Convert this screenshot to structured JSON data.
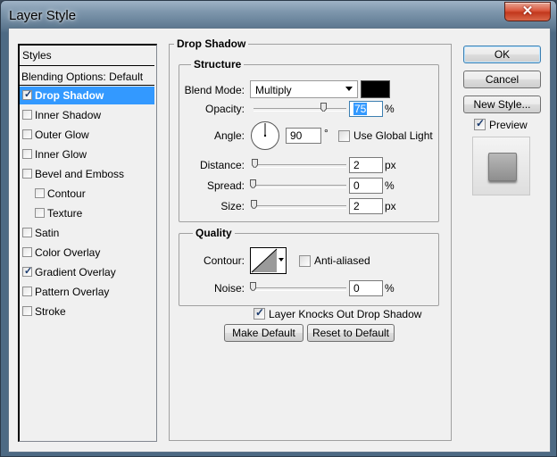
{
  "window": {
    "title": "Layer Style",
    "close_label": "✕"
  },
  "styles_panel": {
    "header": "Styles",
    "blending_options": "Blending Options: Default",
    "items": [
      {
        "label": "Drop Shadow",
        "checked": true,
        "active": true,
        "indent": 0
      },
      {
        "label": "Inner Shadow",
        "checked": false,
        "active": false,
        "indent": 0
      },
      {
        "label": "Outer Glow",
        "checked": false,
        "active": false,
        "indent": 0
      },
      {
        "label": "Inner Glow",
        "checked": false,
        "active": false,
        "indent": 0
      },
      {
        "label": "Bevel and Emboss",
        "checked": false,
        "active": false,
        "indent": 0
      },
      {
        "label": "Contour",
        "checked": false,
        "active": false,
        "indent": 1
      },
      {
        "label": "Texture",
        "checked": false,
        "active": false,
        "indent": 1
      },
      {
        "label": "Satin",
        "checked": false,
        "active": false,
        "indent": 0
      },
      {
        "label": "Color Overlay",
        "checked": false,
        "active": false,
        "indent": 0
      },
      {
        "label": "Gradient Overlay",
        "checked": true,
        "active": false,
        "indent": 0
      },
      {
        "label": "Pattern Overlay",
        "checked": false,
        "active": false,
        "indent": 0
      },
      {
        "label": "Stroke",
        "checked": false,
        "active": false,
        "indent": 0
      }
    ]
  },
  "drop_shadow": {
    "title": "Drop Shadow",
    "structure": {
      "title": "Structure",
      "blend_mode_label": "Blend Mode:",
      "blend_mode_value": "Multiply",
      "shadow_color": "#000000",
      "opacity_label": "Opacity:",
      "opacity_value": "75",
      "opacity_unit": "%",
      "opacity_fraction": 0.75,
      "angle_label": "Angle:",
      "angle_value": "90",
      "angle_unit": "°",
      "use_global_light": "Use Global Light",
      "use_global_light_checked": false,
      "distance_label": "Distance:",
      "distance_value": "2",
      "distance_unit": "px",
      "spread_label": "Spread:",
      "spread_value": "0",
      "spread_unit": "%",
      "size_label": "Size:",
      "size_value": "2",
      "size_unit": "px"
    },
    "quality": {
      "title": "Quality",
      "contour_label": "Contour:",
      "anti_aliased": "Anti-aliased",
      "anti_aliased_checked": false,
      "noise_label": "Noise:",
      "noise_value": "0",
      "noise_unit": "%"
    },
    "layer_knocks_out": "Layer Knocks Out Drop Shadow",
    "layer_knocks_out_checked": true,
    "make_default": "Make Default",
    "reset_to_default": "Reset to Default"
  },
  "buttons": {
    "ok": "OK",
    "cancel": "Cancel",
    "new_style": "New Style...",
    "preview": "Preview",
    "preview_checked": true
  },
  "colors": {
    "selection": "#3399ff",
    "dialog_bg": "#f0f0f0"
  }
}
